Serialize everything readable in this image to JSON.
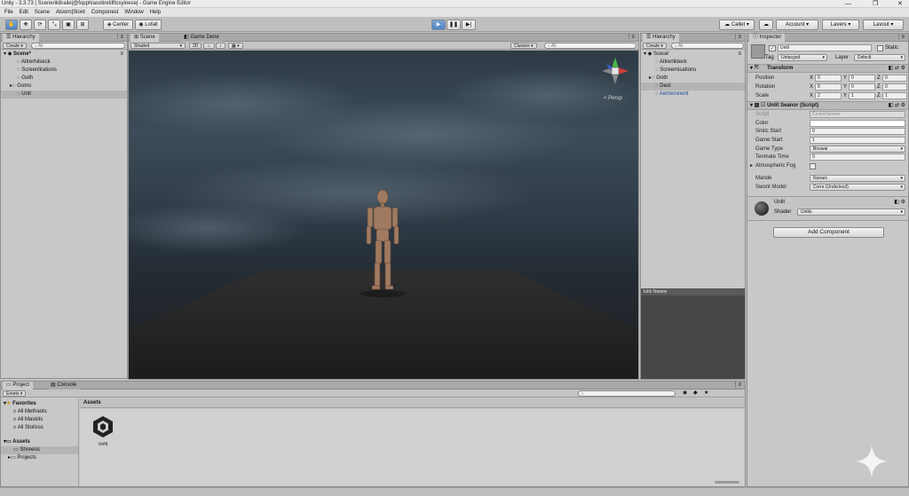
{
  "window": {
    "title": "Unity - 3.3.73 | Scenerik8raile|@fopphiasotiretilftosyinese| - Game Engine Editor",
    "controls": [
      "—",
      "❐",
      "✕"
    ]
  },
  "menu": [
    "File",
    "Edit",
    "Scene",
    "Atoorn|Slont",
    "Componest",
    "Window",
    "Help"
  ],
  "toolbar": {
    "center_label": "Center",
    "local_label": "Lofall",
    "collab_label": "Callet",
    "account_label": "Account",
    "layers_label": "Lavers",
    "layout_label": "Lavout"
  },
  "hierarchy": {
    "tab": "Hierarchy",
    "create": "Create",
    "search_placeholder": "All",
    "scene": "Scene*",
    "items": [
      {
        "label": "Atlrerhilseck"
      },
      {
        "label": "Screenlirations"
      },
      {
        "label": "Goth"
      },
      {
        "label": "Goms"
      },
      {
        "label": "Unit",
        "selected": true
      }
    ]
  },
  "scene": {
    "tabs": [
      "Scene",
      "Game Dene"
    ],
    "shading": "Shaded",
    "mode_2d": "2D",
    "gizmos": "Cluvses",
    "search_placeholder": "All",
    "persp_label": "< Persp"
  },
  "hierarchy2": {
    "tab": "Hierarchy",
    "create": "Create",
    "search_placeholder": "All",
    "scene": "Sceue'",
    "items": [
      {
        "label": "Atlrerlildeck"
      },
      {
        "label": "Screemisations"
      },
      {
        "label": "Goth"
      },
      {
        "label": "Deol",
        "selected": true
      },
      {
        "label": "Aemeronent",
        "blue": true
      }
    ],
    "preview_title": "Ishlr Nwane"
  },
  "inspector": {
    "tab": "Inspecter",
    "object_name": "Unlit",
    "static_label": "Static",
    "tag_label": "Tag",
    "tag_value": "Untacgsd",
    "layer_label": "Layer",
    "layer_value": "Dsfeclt",
    "transform": {
      "title": "Transform",
      "rows": [
        {
          "label": "Position",
          "x": "0",
          "y": "0",
          "z": "0"
        },
        {
          "label": "Rotation",
          "x": "0",
          "y": "0",
          "z": "0"
        },
        {
          "label": "Scale",
          "x": "2",
          "y": "1",
          "z": "1"
        }
      ]
    },
    "script_comp": {
      "title": "Unlit Seanor (Script)",
      "script_label": "Script",
      "script_value": "CmiverSeener",
      "color_label": "Color",
      "smile_start_label": "Smiic Start",
      "smile_start_value": "0",
      "game_start_label": "Game Start",
      "game_start_value": "1",
      "game_type_label": "Game Type",
      "game_type_value": "Bnowal",
      "tenmate_label": "Tenmate Time",
      "tenmate_value": "0",
      "fog_label": "Atmospheric Fog",
      "mande_label": "Mande",
      "mande_value": "Nunarc",
      "swont_label": "Swont Model",
      "swont_value": "Corre (Undcriecd)"
    },
    "material": {
      "name": "Unlit",
      "shader_label": "Shader",
      "shader_value": "Unlits"
    },
    "add_component": "Add Component"
  },
  "project": {
    "tabs": [
      "Project",
      "Console"
    ],
    "create": "Ereets",
    "favorites_title": "Favorites",
    "favorites": [
      "All Methaots",
      "All Maskits",
      "All Stoilsss"
    ],
    "assets_title": "Assets",
    "assets_children": [
      "Shreeos",
      "Projects"
    ],
    "breadcrumb": "Assets",
    "asset_items": [
      {
        "label": "Unfit"
      }
    ]
  },
  "colors": {
    "accent": "#4e84c4",
    "panel_bg": "#c8c8c8",
    "selection": "#b4b4b4"
  }
}
